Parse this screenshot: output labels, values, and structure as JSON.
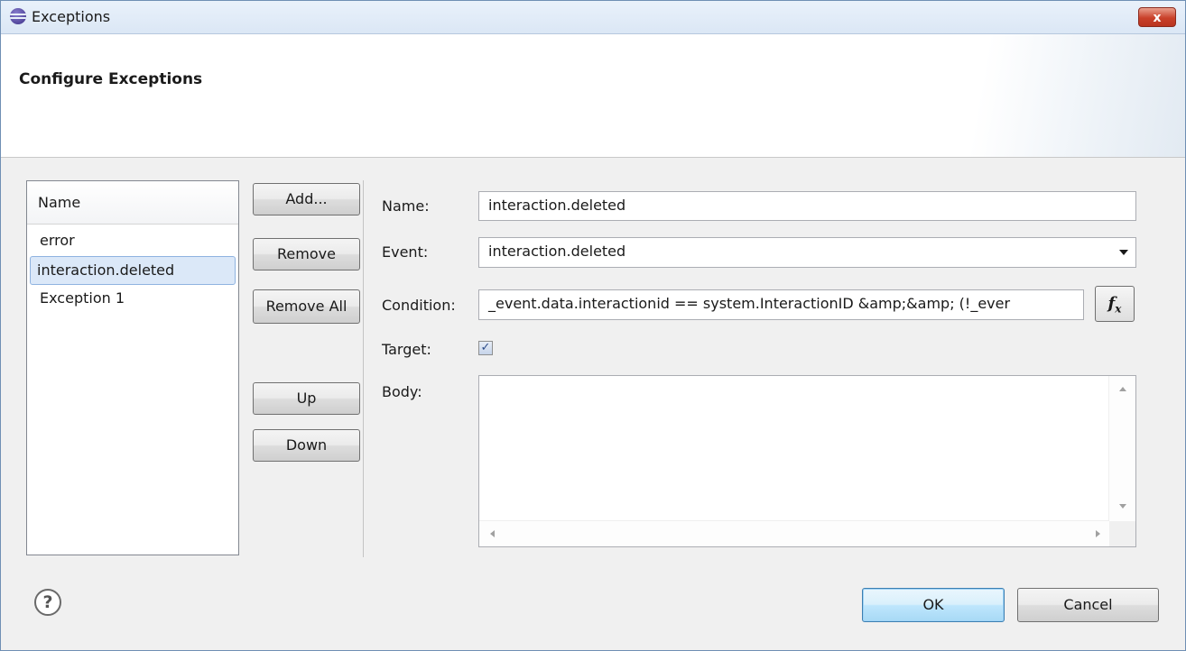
{
  "window": {
    "title": "Exceptions",
    "close_label": "x"
  },
  "banner": {
    "title": "Configure Exceptions"
  },
  "list": {
    "header": "Name",
    "items": [
      "error",
      "interaction.deleted",
      "Exception 1"
    ],
    "selected_index": 1
  },
  "buttons": {
    "add": "Add...",
    "remove": "Remove",
    "remove_all": "Remove All",
    "up": "Up",
    "down": "Down"
  },
  "form": {
    "name_label": "Name:",
    "name_value": "interaction.deleted",
    "event_label": "Event:",
    "event_value": "interaction.deleted",
    "condition_label": "Condition:",
    "condition_value": "_event.data.interactionid == system.InteractionID &amp;&amp; (!_ever",
    "fx_icon": "function-icon",
    "target_label": "Target:",
    "target_checked": true,
    "body_label": "Body:",
    "body_value": ""
  },
  "footer": {
    "help_icon": "help-icon",
    "help_glyph": "?",
    "ok": "OK",
    "cancel": "Cancel"
  }
}
